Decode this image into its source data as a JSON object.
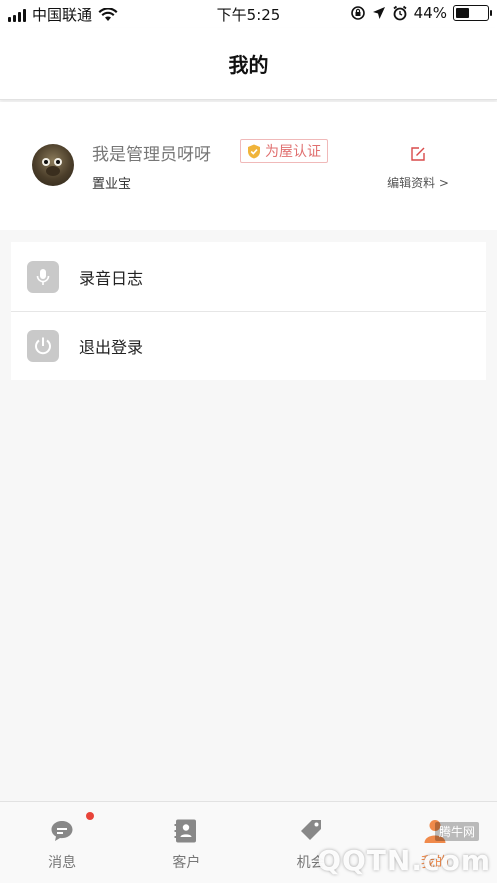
{
  "status_bar": {
    "carrier": "中国联通",
    "time": "下午5:25",
    "battery": "44%",
    "battery_level": 0.44
  },
  "header": {
    "title": "我的"
  },
  "profile": {
    "name": "我是管理员呀呀",
    "badge": "为屋认证",
    "role": "置业宝",
    "edit_label": "编辑资料 >"
  },
  "menu": {
    "items": [
      {
        "label": "录音日志",
        "icon": "microphone-icon"
      },
      {
        "label": "退出登录",
        "icon": "power-icon"
      }
    ]
  },
  "tabs": [
    {
      "label": "消息",
      "icon": "message-icon",
      "badge_dot": true
    },
    {
      "label": "客户",
      "icon": "contacts-icon"
    },
    {
      "label": "机会",
      "icon": "tag-icon"
    },
    {
      "label": "我的",
      "icon": "person-icon",
      "active": true
    }
  ],
  "watermark": {
    "small": "腾牛网",
    "large": "QQTN.com"
  },
  "colors": {
    "accent": "#f08a4b",
    "badge_border": "#f0b9b9",
    "badge_text": "#e07070",
    "dot": "#e8443a",
    "icon_bg": "#c9c9c9"
  }
}
